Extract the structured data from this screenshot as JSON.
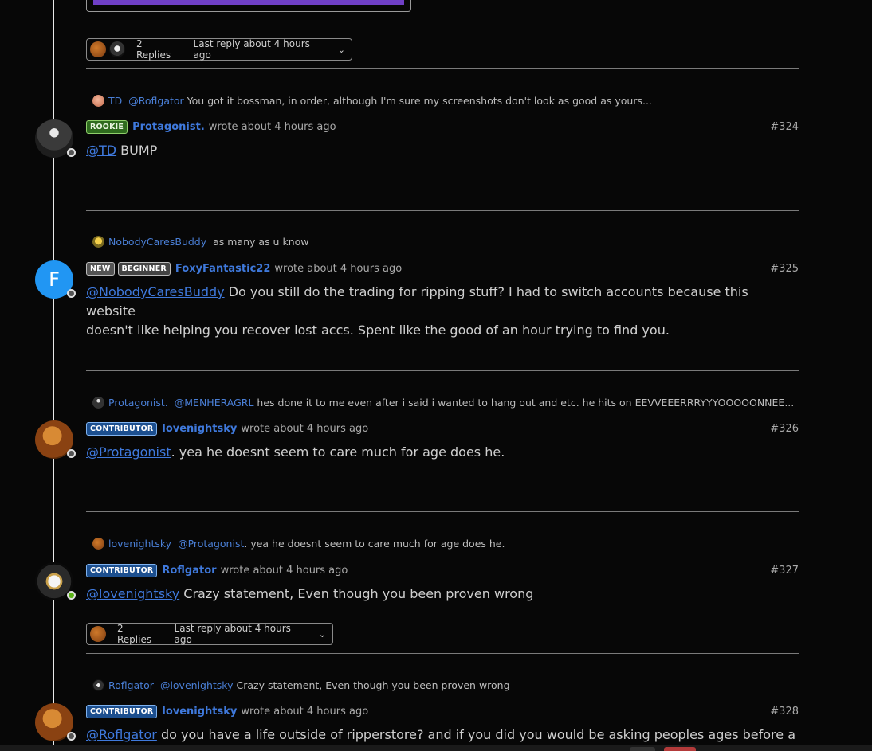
{
  "thread": {
    "top_replies": {
      "count": "2 Replies",
      "last": "Last reply about 4 hours ago"
    },
    "posts": [
      {
        "reply_to": {
          "user": "TD",
          "mention": "@Roflgator",
          "text": " You got it bossman, in order, although I'm sure my screenshots don't look as good as yours..."
        },
        "badges": [
          "ROOKIE"
        ],
        "username": "Protagonist.",
        "meta": "wrote about 4 hours ago",
        "number": "#324",
        "mention": "@TD",
        "text": " BUMP",
        "text2": ""
      },
      {
        "reply_to": {
          "user": "NobodyCaresBuddy",
          "mention": "",
          "text": "as many as u know"
        },
        "badges": [
          "NEW",
          "BEGINNER"
        ],
        "username": "FoxyFantastic22",
        "meta": "wrote about 4 hours ago",
        "number": "#325",
        "mention": "@NobodyCaresBuddy",
        "text": " Do you still do the trading for ripping stuff? I had to switch accounts because this website",
        "text2": "doesn't like helping you recover lost accs. Spent like the good of an hour trying to find you.",
        "avatar_letter": "F"
      },
      {
        "reply_to": {
          "user": "Protagonist.",
          "mention": "@MENHERAGRL",
          "text": " hes done it to me even after i said i wanted to hang out and etc. he hits on EEVVEEERRRYYYOOOOONNEE..."
        },
        "badges": [
          "CONTRIBUTOR"
        ],
        "username": "lovenightsky",
        "meta": "wrote about 4 hours ago",
        "number": "#326",
        "mention": "@Protagonist",
        "text": ". yea he doesnt seem to care much for age does he.",
        "text2": ""
      },
      {
        "reply_to": {
          "user": "lovenightsky",
          "mention": "@Protagonist",
          "text": ". yea he doesnt seem to care much for age does he."
        },
        "badges": [
          "CONTRIBUTOR"
        ],
        "username": "Roflgator",
        "meta": "wrote about 4 hours ago",
        "number": "#327",
        "mention": "@lovenightsky",
        "text": " Crazy statement, Even though you been proven wrong",
        "text2": "",
        "replies": {
          "count": "2 Replies",
          "last": "Last reply about 4 hours ago"
        }
      },
      {
        "reply_to": {
          "user": "Roflgator",
          "mention": "@lovenightsky",
          "text": " Crazy statement, Even though you been proven wrong"
        },
        "badges": [
          "CONTRIBUTOR"
        ],
        "username": "lovenightsky",
        "meta": "wrote about 4 hours ago",
        "number": "#328",
        "mention": "@Roflgator",
        "text": " do you have a life outside of ripperstore? and if you did you would be asking peoples ages before asking",
        "text2": ""
      }
    ]
  },
  "colors": {
    "link": "#3f79dc",
    "contributor": "#1c4f8f",
    "rookie": "#2f6b1e",
    "online": "#5bb318",
    "background": "#070707"
  }
}
